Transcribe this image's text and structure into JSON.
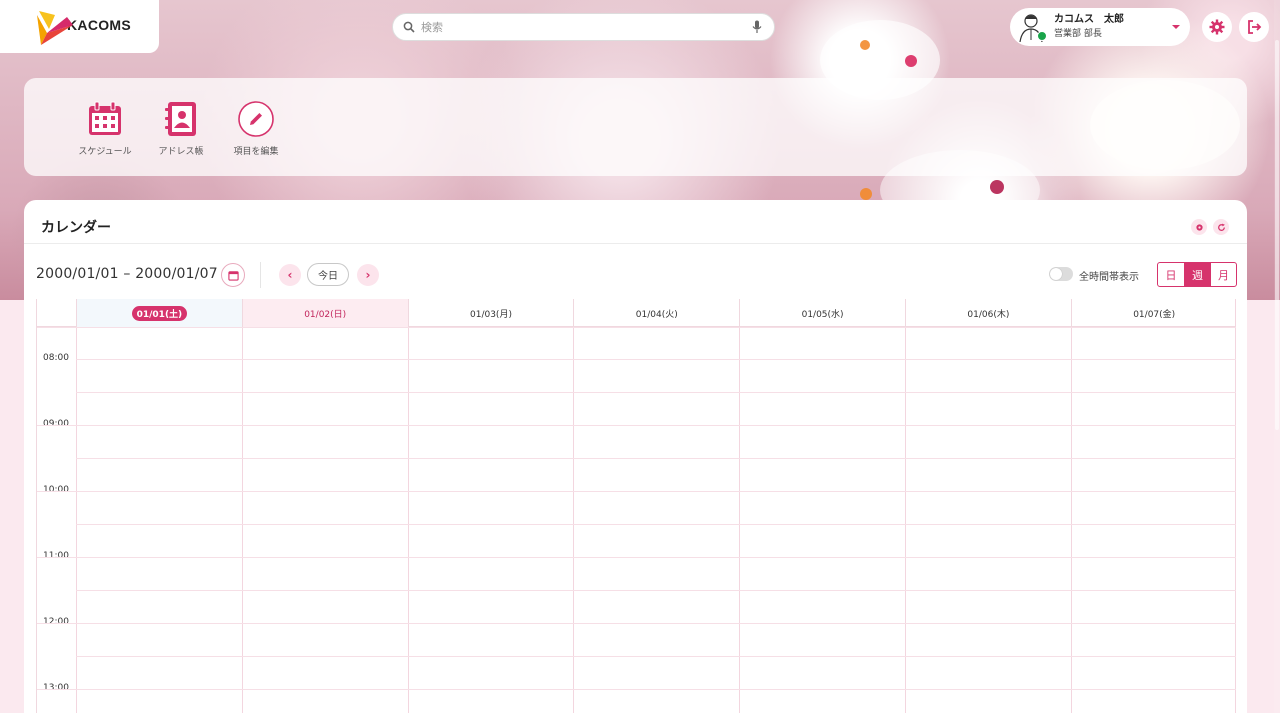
{
  "app": {
    "logo_text": "KACOMS"
  },
  "search": {
    "placeholder": "検索"
  },
  "user": {
    "name": "カコムス　太郎",
    "role": "営業部 部長"
  },
  "quick_links": [
    {
      "label": "スケジュール",
      "icon": "calendar-icon"
    },
    {
      "label": "アドレス帳",
      "icon": "address-book-icon"
    },
    {
      "label": "項目を編集",
      "icon": "pencil-icon"
    }
  ],
  "calendar": {
    "title": "カレンダー",
    "range": "2000/01/01 – 2000/01/07",
    "today_label": "今日",
    "all_hours_label": "全時間帯表示",
    "all_hours_on": false,
    "views": [
      "日",
      "週",
      "月"
    ],
    "active_view": "週",
    "days": [
      "01/01(土)",
      "01/02(日)",
      "01/03(月)",
      "01/04(火)",
      "01/05(水)",
      "01/06(木)",
      "01/07(金)"
    ],
    "times": [
      "08:00",
      "09:00",
      "10:00",
      "11:00",
      "12:00",
      "13:00"
    ]
  },
  "colors": {
    "accent": "#d6336c",
    "accent_light": "#fce4ec"
  }
}
